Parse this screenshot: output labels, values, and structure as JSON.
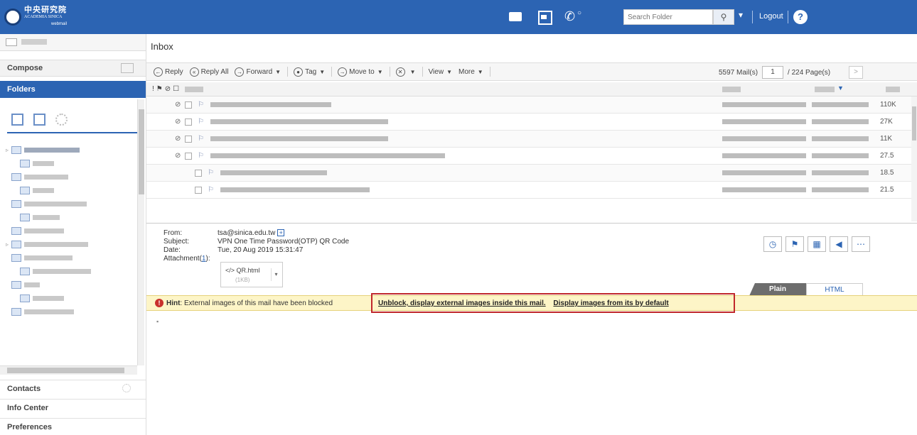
{
  "header": {
    "logo_cn": "中央研究院",
    "logo_en": "ACADEMIA SINICA",
    "logo_sub": "webmail",
    "search_placeholder": "Search Folder",
    "logout_label": "Logout",
    "help_label": "?"
  },
  "sidebar": {
    "compose_label": "Compose",
    "folders_label": "Folders",
    "folder_widths": [
      78,
      30,
      62,
      30,
      88,
      38,
      56,
      90,
      68,
      82,
      22,
      44,
      70
    ],
    "nav": [
      "Contacts",
      "Info Center",
      "Preferences"
    ]
  },
  "main": {
    "title": "Inbox",
    "toolbar": {
      "reply": "Reply",
      "reply_all": "Reply All",
      "forward": "Forward",
      "tag": "Tag",
      "move_to": "Move to",
      "view": "View",
      "more": "More"
    },
    "pager": {
      "mail_count": "5597 Mail(s)",
      "page": "1",
      "page_total": "/ 224 Page(s)"
    },
    "rows": [
      {
        "clip": true,
        "size": "110K"
      },
      {
        "clip": true,
        "size": "27K"
      },
      {
        "clip": true,
        "size": "11K"
      },
      {
        "clip": true,
        "size": "27.5"
      },
      {
        "clip": false,
        "size": "18.5"
      },
      {
        "clip": false,
        "size": "21.5"
      }
    ]
  },
  "preview": {
    "from_label": "From:",
    "from_value": "tsa@sinica.edu.tw",
    "subject_label": "Subject:",
    "subject_value": "VPN One Time Password(OTP) QR Code",
    "date_label": "Date:",
    "date_value": "Tue, 20 Aug 2019 15:31:47",
    "attachment_label": "Attachment(",
    "attachment_count": "1",
    "attachment_suffix": "):",
    "attachment_name": "</> QR.html",
    "attachment_size": "(1KB)",
    "tab_plain": "Plain Text",
    "tab_html": "HTML"
  },
  "hint": {
    "label": "Hint",
    "message": ": External images of this mail have been blocked",
    "link_unblock": "Unblock, display external images inside this mail.",
    "link_default": "Display images from its by default"
  }
}
